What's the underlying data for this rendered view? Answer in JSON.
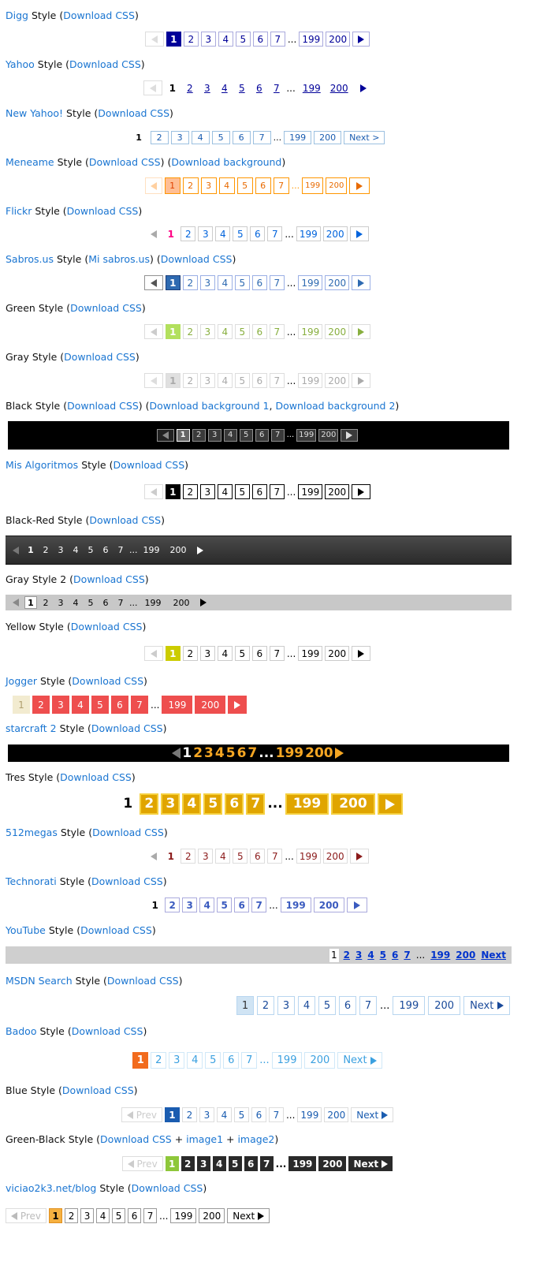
{
  "common": {
    "pages": [
      "1",
      "2",
      "3",
      "4",
      "5",
      "6",
      "7"
    ],
    "dots": "...",
    "last": [
      "199",
      "200"
    ],
    "download_css": "Download CSS",
    "style_word": "Style",
    "next": "Next",
    "next_arrow": "Next >",
    "prev": "Prev"
  },
  "sections": {
    "digg": {
      "name": "Digg"
    },
    "yahoo": {
      "name": "Yahoo"
    },
    "newyahoo": {
      "name": "New Yahoo!"
    },
    "meneame": {
      "name": "Meneame",
      "extra": "Download background"
    },
    "flickr": {
      "name": "Flickr"
    },
    "sabros": {
      "name": "Sabros.us",
      "extra": "Mi sabros.us"
    },
    "green": {
      "name": "Green"
    },
    "gray": {
      "name": "Gray"
    },
    "black": {
      "name": "Black",
      "extra1": "Download background 1",
      "extra2": "Download background 2"
    },
    "misalg": {
      "name": "Mis Algoritmos"
    },
    "blackred": {
      "name": "Black-Red"
    },
    "gray2": {
      "name": "Gray Style 2"
    },
    "yellow": {
      "name": "Yellow"
    },
    "jogger": {
      "name": "Jogger"
    },
    "starcraft": {
      "name": "starcraft 2"
    },
    "tres": {
      "name": "Tres"
    },
    "megas": {
      "name": "512megas"
    },
    "technorati": {
      "name": "Technorati"
    },
    "youtube": {
      "name": "YouTube"
    },
    "msdn": {
      "name": "MSDN Search"
    },
    "badoo": {
      "name": "Badoo"
    },
    "blue": {
      "name": "Blue"
    },
    "greenblack": {
      "name": "Green-Black",
      "image1": "image1",
      "image2": "image2"
    },
    "viciao": {
      "name": "viciao2k3.net/blog"
    }
  },
  "current_page": 1,
  "colors": {
    "link": "#1a75d1",
    "digg": "#000099",
    "meneame": "#ff9600",
    "green": "#b2e05d",
    "yellow": "#cccc00",
    "jogger": "#ee4e4e",
    "starcraft": "#f5a623",
    "tres": "#e0a500",
    "badoo": "#f26b1d",
    "blue": "#1a5cb0",
    "greenblack": "#8ec73a",
    "viciao": "#f5b040"
  },
  "icons": {
    "prev": "triangle-left-icon",
    "next": "triangle-right-icon"
  }
}
